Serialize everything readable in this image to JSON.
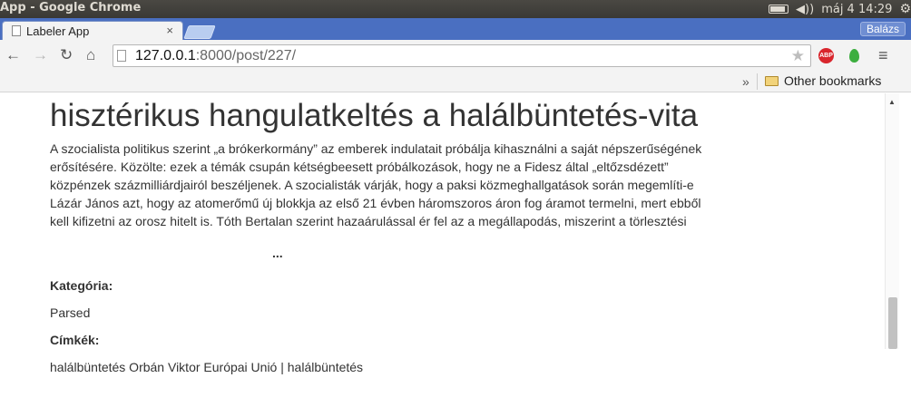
{
  "os": {
    "window_title": "App - Google Chrome",
    "time": "máj 4 14:29",
    "volume_glyph": "◀))"
  },
  "browser": {
    "tab_title": "Labeler App",
    "tab_close": "×",
    "profile_name": "Balázs",
    "url_host": "127.0.0.1",
    "url_path": ":8000/post/227/",
    "abp_label": "ABP",
    "bookmarks_chevron": "»",
    "bookmark_folder": "Other bookmarks"
  },
  "post": {
    "headline": "hisztérikus hangulatkeltés a halálbüntetés-vita",
    "body": "A szocialista politikus szerint „a brókerkormány” az emberek indulatait próbálja kihasználni a saját népszerűségének erősítésére. Közölte: ezek a témák csupán kétségbeesett próbálkozások, hogy ne a Fidesz által „eltőzsdézett” közpénzek százmilliárdjairól beszéljenek. A szocialisták várják, hogy a paksi közmeghallgatások során megemlíti-e Lázár János azt, hogy az atomerőmű új blokkja az első 21 évben háromszoros áron fog áramot termelni, mert ebből kell kifizetni az orosz hitelt is. Tóth Bertalan szerint hazaárulással ér fel az a megállapodás, miszerint a törlesztési",
    "ellipsis": "...",
    "category_label": "Kategória:",
    "category_value": "Parsed",
    "tags_label": "Címkék:",
    "tags_value": "halálbüntetés Orbán Viktor Európai Unió | halálbüntetés"
  }
}
